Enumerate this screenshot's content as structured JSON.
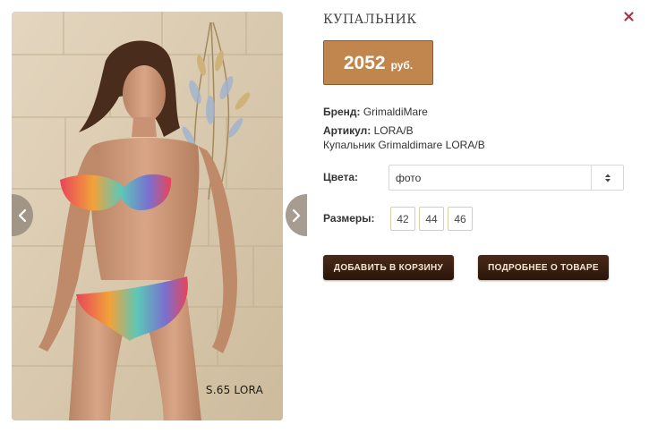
{
  "product": {
    "title": "КУПАЛЬНИК",
    "price_amount": "2052",
    "price_currency": "руб.",
    "brand_label": "Бренд:",
    "brand_value": "GrimaldiMare",
    "article_label": "Артикул:",
    "article_value": "LORA/B",
    "description": "Купальник Grimaldimare LORA/B",
    "photo_caption": "S.65 LORA"
  },
  "options": {
    "colors_label": "Цвета:",
    "colors_selected": "фото",
    "sizes_label": "Размеры:",
    "sizes": [
      "42",
      "44",
      "46"
    ]
  },
  "actions": {
    "add_to_cart": "ДОБАВИТЬ В КОРЗИНУ",
    "details": "ПОДРОБНЕЕ О ТОВАРЕ"
  },
  "icons": {
    "close": "close-icon",
    "prev": "chevron-left-icon",
    "next": "chevron-right-icon",
    "select": "updown-arrows-icon"
  },
  "colors": {
    "price_bg": "#c0864d",
    "button_bg": "#3a1f12",
    "close": "#b0304a",
    "size_border": "#e2c9a8"
  }
}
